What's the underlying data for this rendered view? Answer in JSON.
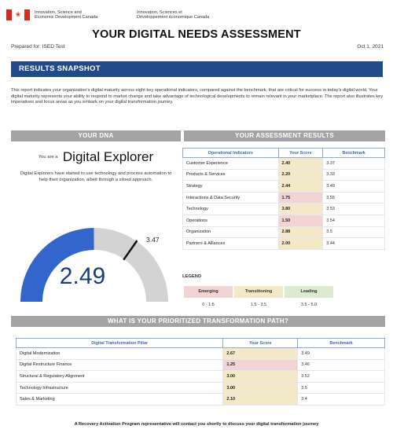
{
  "header": {
    "flag_icon": "canada-flag-icon",
    "dept_en_line1": "Innovation, Science and",
    "dept_en_line2": "Economic Development Canada",
    "dept_fr_line1": "Innovation, Sciences et",
    "dept_fr_line2": "Développement économique Canada"
  },
  "title": "YOUR DIGITAL NEEDS ASSESSMENT",
  "prepared_for": "Prepared for: ISED Test",
  "date": "Oct 1, 2021",
  "snapshot": {
    "heading": "RESULTS SNAPSHOT",
    "intro": "This report indicates your organization's digital maturity across eight key operational indicators, compared against the benchmark, that are critical for success in today's digital world. Your digital maturity represents your ability to respond to market change and take advantage of technological developments to remain relevant in your marketplace. The report also illustrates key imperatives and focus areas as you embark on your digital transformation journey."
  },
  "dna": {
    "heading": "YOUR DNA",
    "you_are": "You are a",
    "value": "Digital Explorer",
    "description": "Digital Explorers have started to use technology and process automation to help their organization, albeit through a siloed approach.",
    "gauge": {
      "score": 2.49,
      "score_label": "2.49",
      "benchmark": 3.47,
      "benchmark_label": "3.47",
      "min": 0,
      "max": 5,
      "fill_color": "#3366cc",
      "track_color": "#d3d3d3"
    }
  },
  "results": {
    "heading": "YOUR ASSESSMENT RESULTS",
    "columns": [
      "Operational Indicators",
      "Your Score",
      "Benchmark"
    ],
    "rows": [
      {
        "indicator": "Customer Experience",
        "score": "2.40",
        "benchmark": "3.37",
        "tone": "tan"
      },
      {
        "indicator": "Products & Services",
        "score": "2.20",
        "benchmark": "3.33",
        "tone": "tan"
      },
      {
        "indicator": "Strategy",
        "score": "2.44",
        "benchmark": "3.49",
        "tone": "tan"
      },
      {
        "indicator": "Interactions & Data Security",
        "score": "1.75",
        "benchmark": "3.55",
        "tone": "pink"
      },
      {
        "indicator": "Technology",
        "score": "3.80",
        "benchmark": "3.53",
        "tone": "tan"
      },
      {
        "indicator": "Operations",
        "score": "1.50",
        "benchmark": "3.54",
        "tone": "pink"
      },
      {
        "indicator": "Organization",
        "score": "2.88",
        "benchmark": "3.5",
        "tone": "tan"
      },
      {
        "indicator": "Partners & Alliances",
        "score": "2.00",
        "benchmark": "3.44",
        "tone": "tan"
      }
    ]
  },
  "legend": {
    "title": "LEGEND",
    "items": [
      {
        "label": "Emerging",
        "range": "0 - 1.5",
        "color": "#f2d4d4"
      },
      {
        "label": "Transitioning",
        "range": "1.5 - 3.5",
        "color": "#f4e9c6"
      },
      {
        "label": "Leading",
        "range": "3.5 - 5.0",
        "color": "#dcebd0"
      }
    ]
  },
  "path": {
    "heading": "WHAT IS YOUR PRIORITIZED TRANSFORMATION PATH?",
    "columns": [
      "Digital Transformation Pillar",
      "Your Score",
      "Benchmark"
    ],
    "rows": [
      {
        "pillar": "Digital Modernization",
        "score": "2.67",
        "benchmark": "3.49",
        "tone": "tan"
      },
      {
        "pillar": "Digital Restructure Finance",
        "score": "1.25",
        "benchmark": "3.46",
        "tone": "pink"
      },
      {
        "pillar": "Structural & Regulatory Alignment",
        "score": "3.00",
        "benchmark": "3.52",
        "tone": "tan"
      },
      {
        "pillar": "Technology Infrastructure",
        "score": "3.00",
        "benchmark": "3.5",
        "tone": "tan"
      },
      {
        "pillar": "Sales & Marketing",
        "score": "2.10",
        "benchmark": "3.4",
        "tone": "tan"
      }
    ]
  },
  "footer": "A Recovery Activation Program representative will contact you shortly to discuss your digital transformation journey"
}
